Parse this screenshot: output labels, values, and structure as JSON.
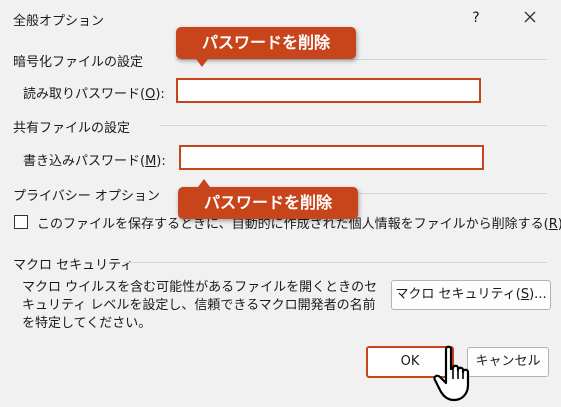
{
  "window": {
    "title": "全般オプション",
    "help_glyph": "?",
    "close_glyph": "×"
  },
  "encryption": {
    "section_label": "暗号化ファイルの設定",
    "field_label": "読み取りパスワード(",
    "field_accel": "O",
    "field_suffix": "):",
    "value": ""
  },
  "sharing": {
    "section_label": "共有ファイルの設定",
    "field_label": "書き込みパスワード(",
    "field_accel": "M",
    "field_suffix": "):",
    "value": ""
  },
  "privacy": {
    "section_label": "プライバシー オプション",
    "checkbox_label": "このファイルを保存するときに、自動的に作成された個人情報をファイルから削除する(",
    "checkbox_accel": "R",
    "checkbox_suffix": ")",
    "checked": false
  },
  "macro": {
    "section_label": "マクロ セキュリティ",
    "description": "マクロ ウイルスを含む可能性があるファイルを開くときのセキュリティ レベルを設定し、信頼できるマクロ開発者の名前を特定してください。",
    "button_label": "マクロ セキュリティ(",
    "button_accel": "S",
    "button_suffix": ")..."
  },
  "buttons": {
    "ok": "OK",
    "cancel": "キャンセル"
  },
  "annotations": {
    "callout_1": "パスワードを削除",
    "callout_2": "パスワードを削除",
    "accent_color": "#c8451c"
  }
}
